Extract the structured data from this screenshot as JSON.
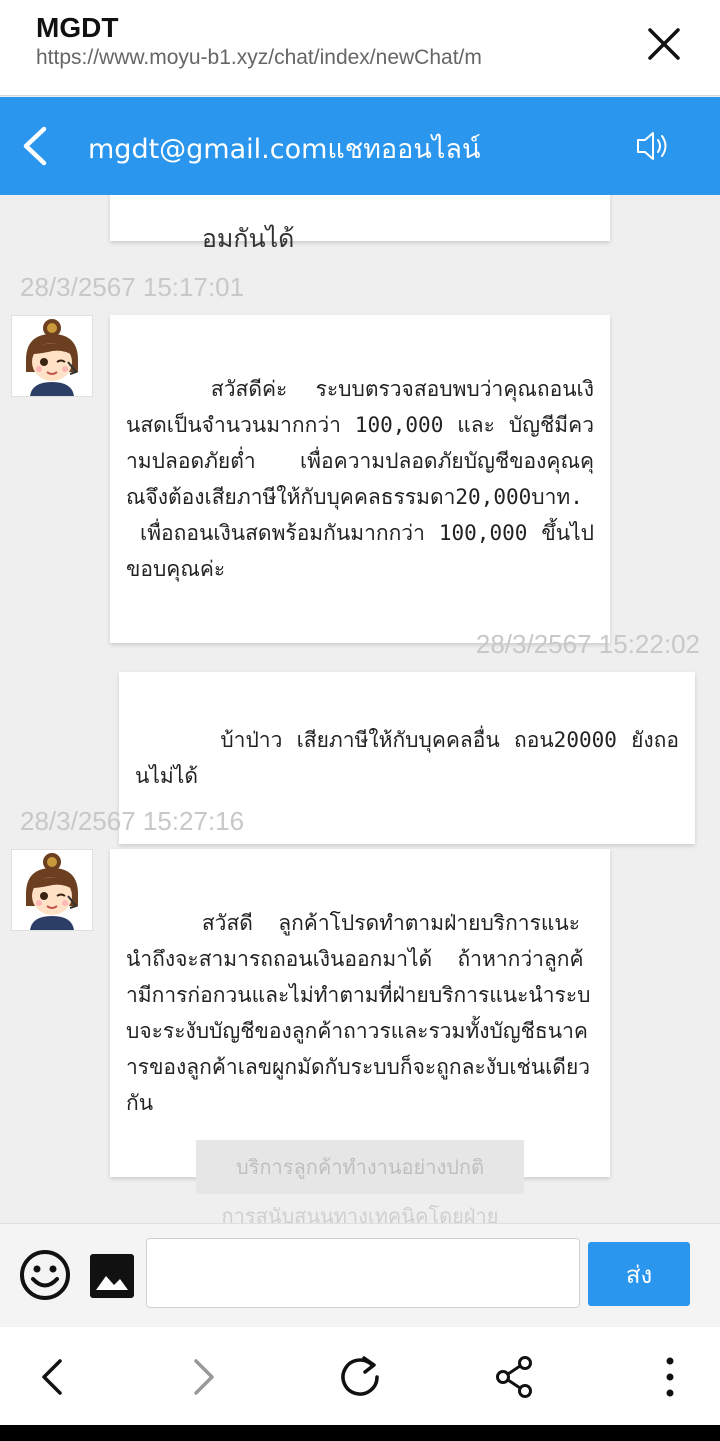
{
  "browser": {
    "title": "MGDT",
    "url": "https://www.moyu-b1.xyz/chat/index/newChat/m"
  },
  "header": {
    "title": "mgdt@gmail.comแชทออนไลน์"
  },
  "messages": [
    {
      "side": "agent",
      "timestamp": "",
      "text": "อมกันได้"
    },
    {
      "side": "agent",
      "timestamp": "28/3/2567 15:17:01",
      "text": "สวัสดีค่ะ  ระบบตรวจสอบพบว่าคุณถอนเงินสดเป็นจำนวนมากกว่า 100,000 และ บัญชีมีความปลอดภัยต่ำ  เพื่อความปลอดภัยบัญชีของคุณคุณจึงต้องเสียภาษีให้กับบุคคลธรรมดา20,000บาท.\n เพื่อถอนเงินสดพร้อมกันมากกว่า 100,000 ขึ้นไป  ขอบคุณค่ะ"
    },
    {
      "side": "user",
      "timestamp": "28/3/2567 15:22:02",
      "text": "บ้าป่าว เสียภาษีให้กับบุคคลอื่น ถอน20000 ยังถอนไม่ได้"
    },
    {
      "side": "agent",
      "timestamp": "28/3/2567 15:27:16",
      "text": "สวัสดี  ลูกค้าโปรดทำตามฝ่ายบริการแนะนำถึงจะสามารถถอนเงินออกมาได้  ถ้าหากว่าลูกค้ามีการก่อกวนและไม่ทำตามที่ฝ่ายบริการแนะนำระบบจะระงับบัญชีของลูกค้าถาวรและรวมทั้งบัญชีธนาคารของลูกค้าเลขผูกมัดกับระบบก็จะถูกละงับเช่นเดียวกัน"
    }
  ],
  "service_notice": {
    "line1": "บริการลูกค้าทำงานอย่างปกติ",
    "line2": "การสนับสนุนทางเทคนิคโดยฝ่าย"
  },
  "input": {
    "value": "",
    "placeholder": "",
    "send_label": "ส่ง"
  },
  "icons": {
    "close": "close-icon",
    "back": "chevron-left-icon",
    "speaker": "speaker-icon",
    "emoji": "smiley-icon",
    "image": "image-icon",
    "nav_back": "chevron-left-icon",
    "nav_forward": "chevron-right-icon",
    "reload": "reload-icon",
    "share": "share-icon",
    "more": "more-vertical-icon"
  },
  "colors": {
    "accent": "#2b96ee",
    "background": "#efefef",
    "timestamp": "#c8c8c8"
  }
}
